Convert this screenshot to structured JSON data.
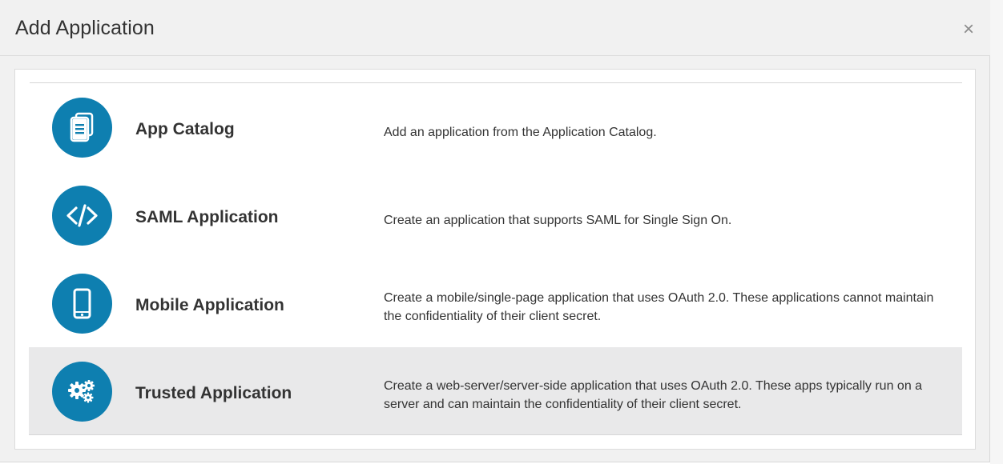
{
  "dialog": {
    "title": "Add Application",
    "close_glyph": "×"
  },
  "options": [
    {
      "name": "App Catalog",
      "description": "Add an application from the Application Catalog.",
      "icon": "catalog-icon"
    },
    {
      "name": "SAML Application",
      "description": "Create an application that supports SAML for Single Sign On.",
      "icon": "code-icon"
    },
    {
      "name": "Mobile Application",
      "description": "Create a mobile/single-page application that uses OAuth 2.0. These applications cannot maintain the confidentiality of their client secret.",
      "icon": "mobile-phone-icon"
    },
    {
      "name": "Trusted Application",
      "description": "Create a web-server/server-side application that uses OAuth 2.0. These apps typically run on a server and can maintain the confidentiality of their client secret.",
      "icon": "gears-icon",
      "selected": true
    }
  ],
  "colors": {
    "accent": "#0e7fb0",
    "selected_row": "#e9e9ea",
    "header_bg": "#f1f1f1"
  }
}
